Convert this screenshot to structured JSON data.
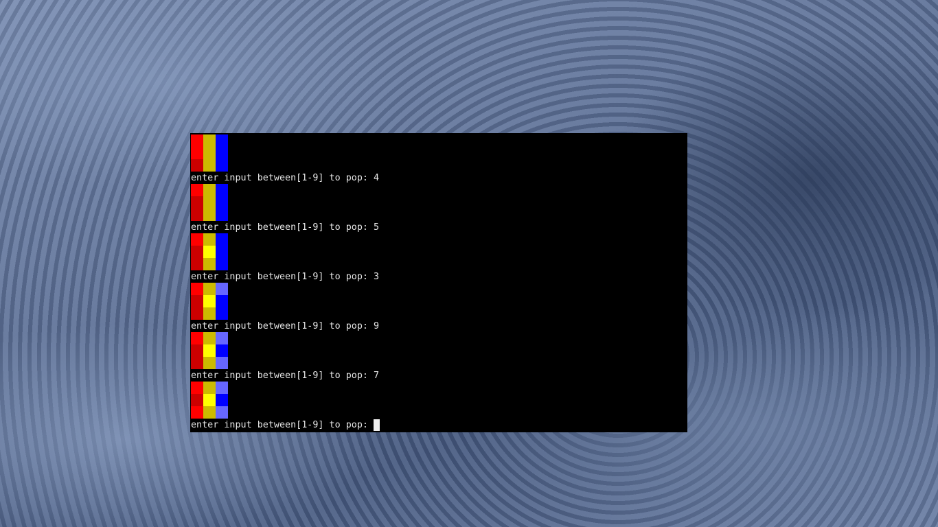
{
  "terminal": {
    "prompt_text": "enter input between[1-9] to pop: ",
    "palette": {
      "R1": "#ff0000",
      "R2": "#cc0000",
      "Y1": "#ffff00",
      "Y2": "#ccbb00",
      "B1": "#0000ff",
      "B2": "#6666ff"
    },
    "entries": [
      {
        "grid": [
          [
            "R1",
            "Y2",
            "B1"
          ],
          [
            "R1",
            "Y2",
            "B1"
          ],
          [
            "R2",
            "Y2",
            "B1"
          ]
        ],
        "prompt": "enter input between[1-9] to pop: 4"
      },
      {
        "grid": [
          [
            "R1",
            "Y2",
            "B1"
          ],
          [
            "R2",
            "Y2",
            "B1"
          ],
          [
            "R2",
            "Y2",
            "B1"
          ]
        ],
        "prompt": "enter input between[1-9] to pop: 5"
      },
      {
        "grid": [
          [
            "R1",
            "Y2",
            "B1"
          ],
          [
            "R2",
            "Y1",
            "B1"
          ],
          [
            "R2",
            "Y2",
            "B1"
          ]
        ],
        "prompt": "enter input between[1-9] to pop: 3"
      },
      {
        "grid": [
          [
            "R1",
            "Y2",
            "B2"
          ],
          [
            "R2",
            "Y1",
            "B1"
          ],
          [
            "R2",
            "Y2",
            "B1"
          ]
        ],
        "prompt": "enter input between[1-9] to pop: 9"
      },
      {
        "grid": [
          [
            "R1",
            "Y2",
            "B2"
          ],
          [
            "R2",
            "Y1",
            "B1"
          ],
          [
            "R2",
            "Y2",
            "B2"
          ]
        ],
        "prompt": "enter input between[1-9] to pop: 7"
      },
      {
        "grid": [
          [
            "R1",
            "Y2",
            "B2"
          ],
          [
            "R2",
            "Y1",
            "B1"
          ],
          [
            "R1",
            "Y2",
            "B2"
          ]
        ],
        "prompt": "enter input between[1-9] to pop: ",
        "active": true
      }
    ]
  }
}
